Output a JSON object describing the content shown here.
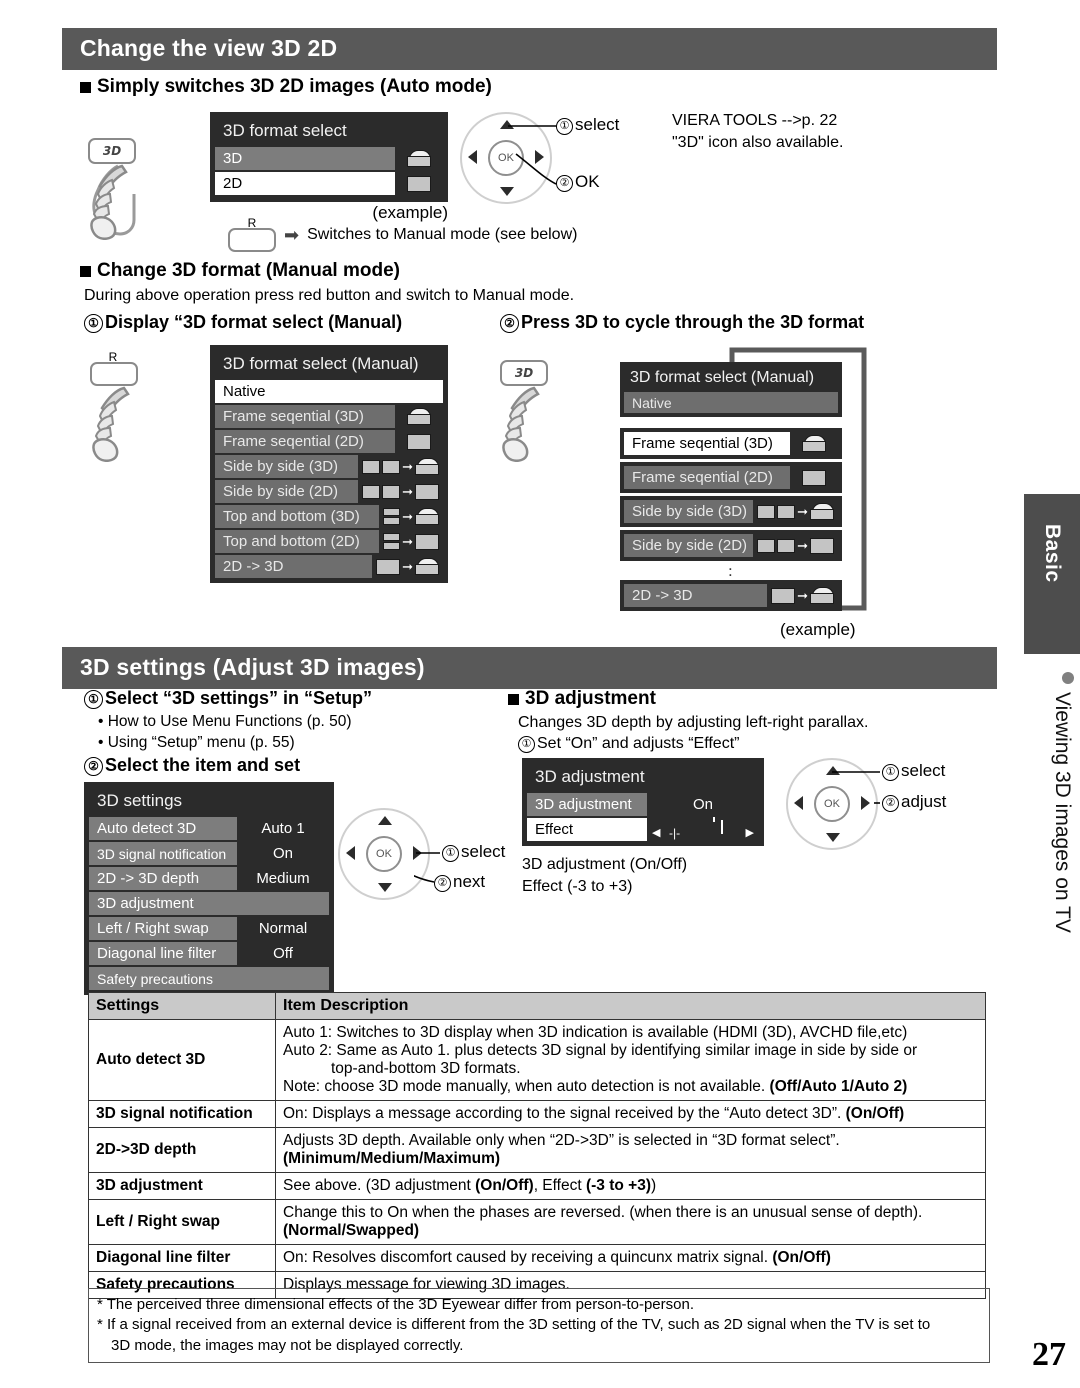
{
  "page": {
    "number": "27"
  },
  "side_tab": {
    "label": "Basic",
    "caption": "Viewing 3D images on TV"
  },
  "section1": {
    "title": "Change the view 3D   2D",
    "subhead": "Simply switches 3D      2D images (Auto mode)",
    "osd": {
      "title": "3D format select",
      "rows": [
        {
          "label": "3D",
          "icon": "cube-3d-icon"
        },
        {
          "label": "2D",
          "icon": "rect-2d-icon"
        }
      ]
    },
    "example_label": "(example)",
    "dpad": {
      "ok": "OK",
      "callout1": "select",
      "callout2": "OK",
      "num1": "①",
      "num2": "②"
    },
    "note_lines": [
      "VIERA TOOLS -->p. 22",
      "\"3D\" icon also available."
    ],
    "red_button": {
      "key": "R",
      "text": "Switches to Manual mode (see below)"
    }
  },
  "section2": {
    "subhead": "Change 3D format (Manual mode)",
    "intro": "During above operation press red button and switch to Manual mode.",
    "step1": {
      "num": "①",
      "text": "Display “3D format select (Manual)"
    },
    "step2": {
      "num": "②",
      "text": "Press 3D to cycle through the 3D format"
    },
    "osd_left": {
      "title": "3D format select (Manual)",
      "rows": [
        {
          "label": "Native",
          "icon": "",
          "state": "selected"
        },
        {
          "label": "Frame seqential (3D)",
          "icon": "cube-3d-icon",
          "state": "normal"
        },
        {
          "label": "Frame seqential (2D)",
          "icon": "rect-2d-icon",
          "state": "normal"
        },
        {
          "label": "Side by side (3D)",
          "icon": "sbs-to-cube-icon",
          "state": "normal"
        },
        {
          "label": "Side by side (2D)",
          "icon": "sbs-to-rect-icon",
          "state": "normal"
        },
        {
          "label": "Top and bottom (3D)",
          "icon": "tab-to-cube-icon",
          "state": "normal"
        },
        {
          "label": "Top and bottom (2D)",
          "icon": "tab-to-rect-icon",
          "state": "normal"
        },
        {
          "label": "2D -> 3D",
          "icon": "rect-to-cube-icon",
          "state": "normal"
        }
      ]
    },
    "osd_right": {
      "title": "3D format select (Manual)",
      "rows": [
        {
          "label": "Native",
          "icon": "",
          "state": "header-row"
        },
        {
          "label": "Frame seqential (3D)",
          "icon": "cube-3d-icon",
          "state": "selected"
        },
        {
          "label": "Frame seqential (2D)",
          "icon": "rect-2d-icon",
          "state": "normal"
        },
        {
          "label": "Side by side (3D)",
          "icon": "sbs-to-cube-icon",
          "state": "normal"
        },
        {
          "label": "Side by side (2D)",
          "icon": "sbs-to-rect-icon",
          "state": "normal"
        },
        {
          "label": "2D -> 3D",
          "icon": "rect-to-cube-icon",
          "state": "normal"
        }
      ],
      "example_label": "(example)"
    }
  },
  "section3": {
    "title": "3D settings (Adjust 3D images)",
    "step1": {
      "num": "①",
      "text": "Select “3D settings” in “Setup”"
    },
    "step1_bullets": [
      "How to Use Menu Functions (p. 50)",
      "Using “Setup” menu (p. 55)"
    ],
    "step2": {
      "num": "②",
      "text": "Select the item and set"
    },
    "settings_osd": {
      "title": "3D settings",
      "rows": [
        {
          "label": "Auto detect 3D",
          "value": "Auto 1"
        },
        {
          "label": "3D signal notification",
          "value": "On"
        },
        {
          "label": "2D -> 3D depth",
          "value": "Medium"
        },
        {
          "label": "3D adjustment",
          "value": ""
        },
        {
          "label": "Left / Right swap",
          "value": "Normal"
        },
        {
          "label": "Diagonal line filter",
          "value": "Off"
        },
        {
          "label": "Safety precautions",
          "value": ""
        }
      ]
    },
    "dpad_left": {
      "ok": "OK",
      "callout1": "select",
      "callout2": "next",
      "num1": "①",
      "num2": "②"
    },
    "adjustment": {
      "head": "3D adjustment",
      "desc": "Changes 3D depth by adjusting left-right parallax.",
      "step": {
        "num": "①",
        "text": "Set “On” and adjusts “Effect”"
      },
      "osd": {
        "title": "3D adjustment",
        "rows": [
          {
            "label": "3D adjustment",
            "value": "On"
          },
          {
            "label": "Effect",
            "value": "slider"
          }
        ]
      },
      "caption_lines": [
        "3D adjustment (On/Off)",
        "Effect (-3 to +3)"
      ],
      "dpad": {
        "ok": "OK",
        "callout1": "select",
        "callout2": "adjust",
        "num1": "①",
        "num2": "②"
      }
    }
  },
  "table": {
    "headers": [
      "Settings",
      "Item Description"
    ],
    "rows": [
      {
        "key": "Auto detect 3D",
        "lines": [
          "Auto 1: Switches to 3D display when 3D indication is available (HDMI (3D), AVCHD file,etc)",
          "Auto 2: Same as Auto 1. plus detects 3D signal by identifying similar image in side by side or",
          "top-and-bottom 3D formats.",
          "Note: choose 3D mode manually, when auto detection is not available."
        ],
        "bold_tail": "(Off/Auto 1/Auto 2)"
      },
      {
        "key": "3D signal notification",
        "lines": [
          "On: Displays a message according to the signal received by the “Auto detect 3D”."
        ],
        "bold_tail": "(On/Off)"
      },
      {
        "key": "2D->3D depth",
        "lines": [
          "Adjusts 3D depth. Available only when “2D->3D” is selected in “3D format select”."
        ],
        "bold_tail": "(Minimum/Medium/Maximum)"
      },
      {
        "key": "3D adjustment",
        "lines": [
          "See above. (3D adjustment (On/Off), Effect (-3 to +3))"
        ],
        "bold_tail": ""
      },
      {
        "key": "Left / Right swap",
        "lines": [
          "Change this to On when the phases are reversed. (when there is an unusual sense of depth)."
        ],
        "bold_tail": "(Normal/Swapped)"
      },
      {
        "key": "Diagonal line filter",
        "lines": [
          "On: Resolves discomfort caused by receiving a quincunx matrix signal."
        ],
        "bold_tail": "(On/Off)"
      },
      {
        "key": "Safety precautions",
        "lines": [
          "Displays message for viewing 3D images."
        ],
        "bold_tail": ""
      }
    ]
  },
  "footnotes": [
    "* The perceived three dimensional effects of the 3D Eyewear differ from person-to-person.",
    "* If a signal received from an external device is different from the 3D setting of the TV, such as 2D signal when the TV is set to",
    "3D mode, the images may not be displayed correctly."
  ]
}
